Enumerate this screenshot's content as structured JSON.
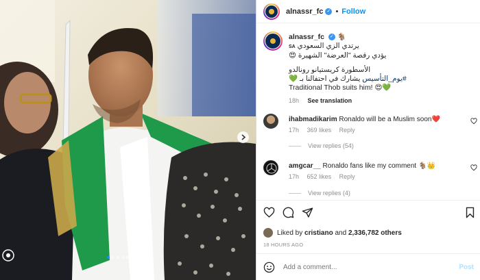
{
  "post": {
    "username": "alnassr_fc",
    "follow_label": "Follow",
    "separator": "•",
    "photo_alt": "Cristiano Ronaldo wearing traditional Saudi thob with green scarf holding a sword",
    "carousel_dots": 8,
    "carousel_active": 0
  },
  "caption": {
    "username": "alnassr_fc",
    "emoji_after_name": "🐐",
    "flag": "SA",
    "line1": "يرتدي الزي السعودي",
    "line2": "يؤدي رقصة \"العرضة\" الشهيرة 😍",
    "line3": "الأسطورة كريستيانو رونالدو",
    "line4_tag": "#يوم_التأسيس",
    "line4_rest": " يشارك في احتفالنا بـ 💚",
    "line5": "Traditional Thob suits him! 😍💚",
    "age": "18h",
    "see_translation": "See translation"
  },
  "comments": [
    {
      "username": "ihabmadikarim",
      "text": "Ronaldo will be a Muslim soon❤️",
      "age": "17h",
      "likes": "369 likes",
      "reply": "Reply",
      "view_replies": "View replies (54)"
    },
    {
      "username": "amgcar__",
      "text": "Ronaldo fans like my comment 🐐👑",
      "age": "17h",
      "likes": "652 likes",
      "reply": "Reply",
      "view_replies": "View replies (4)"
    }
  ],
  "likes": {
    "prefix": "Liked by",
    "user": "cristiano",
    "and": "and",
    "count": "2,336,782 others"
  },
  "date": "18 HOURS AGO",
  "add_comment": {
    "placeholder": "Add a comment...",
    "post_label": "Post"
  },
  "colors": {
    "accent": "#0095f6",
    "link": "#00376b",
    "muted": "#8e8e8e",
    "scarf_green": "#1f9a4a"
  },
  "icons": [
    "heart-icon",
    "comment-icon",
    "share-icon",
    "bookmark-icon",
    "emoji-icon",
    "verified-icon",
    "carousel-next-icon"
  ]
}
